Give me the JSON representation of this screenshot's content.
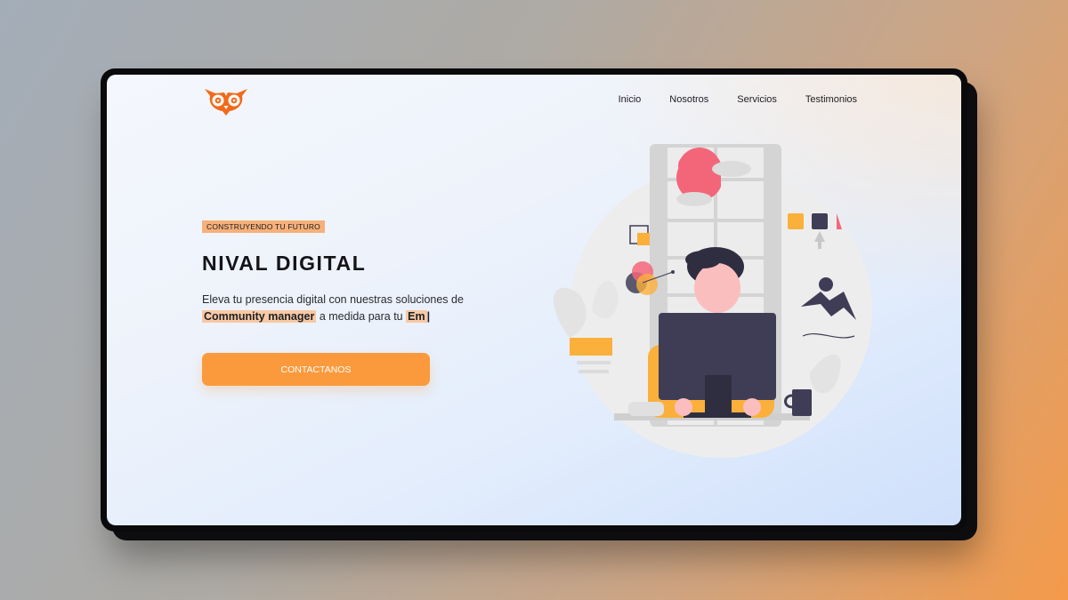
{
  "brand": {
    "logo_icon": "owl-logo-icon",
    "accent_color": "#fb9a3c",
    "logo_color": "#f26a1b"
  },
  "nav": {
    "items": [
      {
        "label": "Inicio"
      },
      {
        "label": "Nosotros"
      },
      {
        "label": "Servicios"
      },
      {
        "label": "Testimonios"
      }
    ]
  },
  "hero": {
    "badge": "CONSTRUYENDO TU FUTURO",
    "title": "NIVAL DIGITAL",
    "description_line1": "Eleva tu presencia digital con nuestras soluciones de",
    "highlight": "Community manager",
    "description_after": "a medida para tu",
    "typed_text": "Em",
    "typing_cursor": "|",
    "cta_label": "CONTACTANOS"
  },
  "illustration": {
    "icon": "person-at-computer-illustration"
  }
}
